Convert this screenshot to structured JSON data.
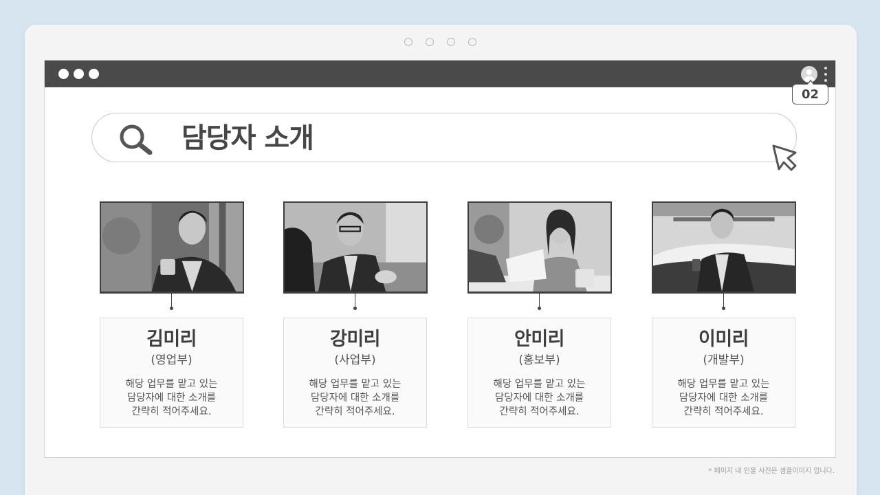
{
  "window": {
    "page_number": "02"
  },
  "search": {
    "title": "담당자 소개"
  },
  "cards": [
    {
      "name": "김미리",
      "dept": "(영업부)",
      "desc": [
        "해당 업무를 맡고 있는",
        "담당자에 대한 소개를",
        "간략히 적어주세요."
      ]
    },
    {
      "name": "강미리",
      "dept": "(사업부)",
      "desc": [
        "해당 업무를 맡고 있는",
        "담당자에 대한 소개를",
        "간략히 적어주세요."
      ]
    },
    {
      "name": "안미리",
      "dept": "(홍보부)",
      "desc": [
        "해당 업무를 맡고 있는",
        "담당자에 대한 소개를",
        "간략히 적어주세요."
      ]
    },
    {
      "name": "이미리",
      "dept": "(개발부)",
      "desc": [
        "해당 업무를 맡고 있는",
        "담당자에 대한 소개를",
        "간략히 적어주세요."
      ]
    }
  ],
  "footnote": "* 페이지 내 인물 사진은 샘플이미지 입니다.",
  "icons": {
    "search": "search-icon",
    "cursor": "cursor-icon",
    "user": "user-icon",
    "more": "more-vertical-icon"
  },
  "colors": {
    "background": "#d6e5f0",
    "titlebar": "#4a4a4a",
    "text_dark": "#464646"
  }
}
